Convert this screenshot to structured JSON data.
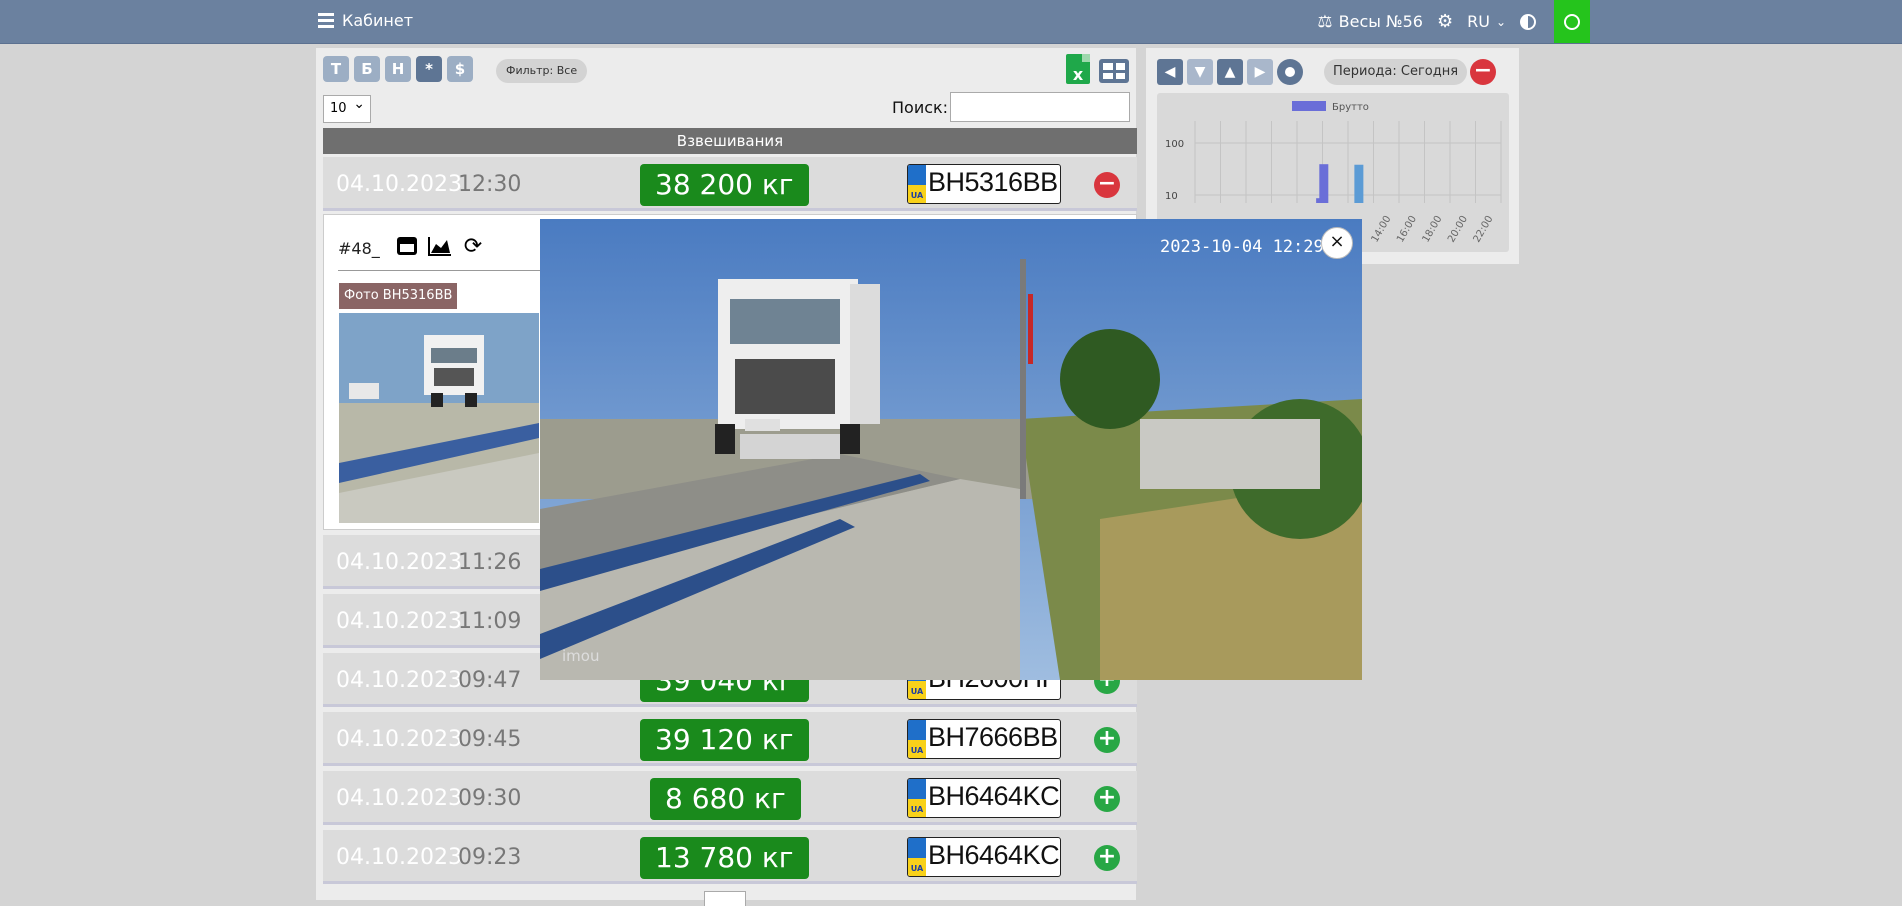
{
  "header": {
    "brand": "Кабинет",
    "scale_label": "Весы №56",
    "lang": "RU",
    "icons": [
      "menu-icon",
      "scale-icon",
      "gear-icon",
      "chevron-down-icon",
      "contrast-icon",
      "user-icon"
    ]
  },
  "toolbar": {
    "type_buttons": [
      "Т",
      "Б",
      "Н",
      "*",
      "$"
    ],
    "active_type": "*",
    "filter_label": "Фильтр: Все",
    "per_page": "10",
    "search_label": "Поиск:",
    "search_value": ""
  },
  "table": {
    "title": "Взвешивания",
    "rows": [
      {
        "date": "04.10.2023",
        "time": "12:30",
        "weight": "38 200 кг",
        "plate": "BH5316BB",
        "expanded": true
      },
      {
        "date": "04.10.2023",
        "time": "11:26",
        "weight": "",
        "plate": ""
      },
      {
        "date": "04.10.2023",
        "time": "11:09",
        "weight": "",
        "plate": ""
      },
      {
        "date": "04.10.2023",
        "time": "09:47",
        "weight": "39 040 кг",
        "plate": "BH2600HP"
      },
      {
        "date": "04.10.2023",
        "time": "09:45",
        "weight": "39 120 кг",
        "plate": "BH7666BB"
      },
      {
        "date": "04.10.2023",
        "time": "09:30",
        "weight": "8 680 кг",
        "plate": "BH6464KC"
      },
      {
        "date": "04.10.2023",
        "time": "09:23",
        "weight": "13 780 кг",
        "plate": "BH6464KC"
      }
    ],
    "plate_country": "UA"
  },
  "detail": {
    "id_label": "#48_",
    "photo_tag": "Фото BH5316BB"
  },
  "period": {
    "label": "Периода: Сегодня"
  },
  "chart_data": {
    "type": "bar",
    "legend": [
      "Брутто"
    ],
    "yscale": "log",
    "yticks": [
      "100",
      "10"
    ],
    "x_labels": [
      "14:00",
      "16:00",
      "18:00",
      "20:00",
      "22:00"
    ],
    "series": [
      {
        "name": "Брутто",
        "values": [
          {
            "x": "09:30",
            "y": 8.68
          },
          {
            "x": "09:45",
            "y": 39.12
          },
          {
            "x": "12:30",
            "y": 38.2
          }
        ]
      }
    ]
  },
  "modal": {
    "timestamp": "2023-10-04 12:29:2",
    "watermark": "imou",
    "close_label": "×"
  },
  "colors": {
    "topbar": "#6b819f",
    "weight_green": "#1a8a1c",
    "user_green": "#25c41c",
    "bar": "#6a6ed8"
  }
}
